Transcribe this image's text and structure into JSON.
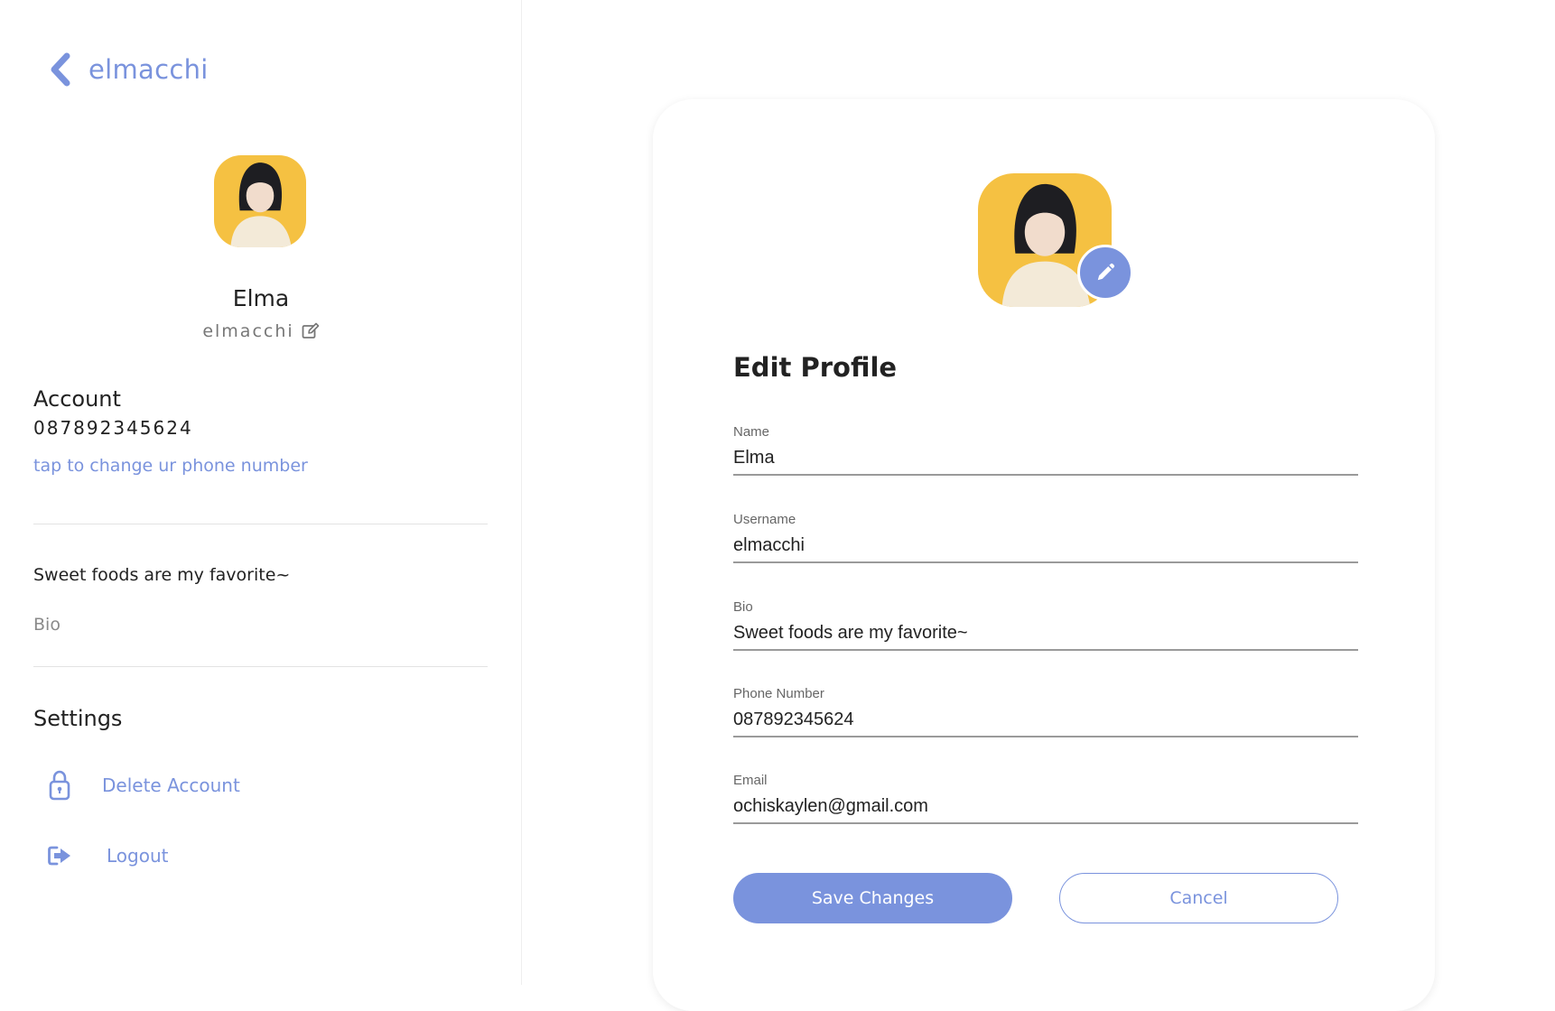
{
  "colors": {
    "accent": "#7a93dd",
    "avatar_background": "#f5c142"
  },
  "sidebar": {
    "back_title": "elmacchi",
    "profile": {
      "name": "Elma",
      "username": "elmacchi"
    },
    "account": {
      "title": "Account",
      "phone": "087892345624",
      "change_phone_link": "tap to change ur phone number"
    },
    "bio": {
      "text": "Sweet foods are my favorite~",
      "caption": "Bio"
    },
    "settings": {
      "title": "Settings",
      "items": [
        {
          "label": "Delete Account",
          "icon": "lock-icon"
        },
        {
          "label": "Logout",
          "icon": "logout-icon"
        }
      ]
    }
  },
  "edit_profile": {
    "title": "Edit Profile",
    "fields": {
      "name": {
        "label": "Name",
        "value": "Elma"
      },
      "username": {
        "label": "Username",
        "value": "elmacchi"
      },
      "bio": {
        "label": "Bio",
        "value": "Sweet foods are my favorite~"
      },
      "phone": {
        "label": "Phone Number",
        "value": "087892345624"
      },
      "email": {
        "label": "Email",
        "value": "ochiskaylen@gmail.com"
      }
    },
    "save_label": "Save Changes",
    "cancel_label": "Cancel"
  }
}
